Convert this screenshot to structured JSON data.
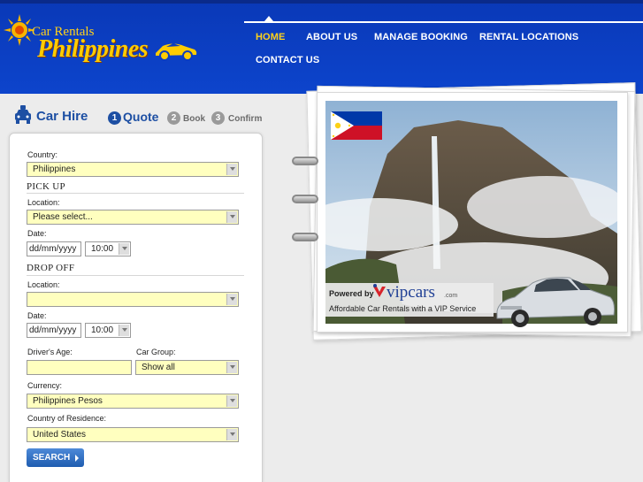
{
  "logo": {
    "top_text": "Car Rentals",
    "main_text": "Philippines",
    "colors": {
      "sun": "#f7b500",
      "text": "#ffcc00",
      "car": "#ffcc00"
    }
  },
  "nav": {
    "items": [
      {
        "label": "HOME",
        "active": true
      },
      {
        "label": "ABOUT US",
        "active": false
      },
      {
        "label": "MANAGE BOOKING",
        "active": false
      },
      {
        "label": "RENTAL LOCATIONS",
        "active": false
      },
      {
        "label": "CONTACT US",
        "active": false
      }
    ],
    "colors": {
      "background": "#0b3cc0",
      "active": "#ffd21a",
      "inactive": "#ffffff"
    }
  },
  "hire": {
    "title": "Car Hire",
    "steps": [
      {
        "number": "1",
        "label": "Quote",
        "current": true
      },
      {
        "number": "2",
        "label": "Book",
        "current": false
      },
      {
        "number": "3",
        "label": "Confirm",
        "current": false
      }
    ]
  },
  "form": {
    "country": {
      "label": "Country:",
      "value": "Philippines"
    },
    "pickup": {
      "heading": "PICK UP",
      "location_label": "Location:",
      "location_value": "Please select...",
      "date_label": "Date:",
      "date_value": "dd/mm/yyyy",
      "time_value": "10:00"
    },
    "dropoff": {
      "heading": "DROP OFF",
      "location_label": "Location:",
      "location_value": "",
      "date_label": "Date:",
      "date_value": "dd/mm/yyyy",
      "time_value": "10:00"
    },
    "age": {
      "label": "Driver's Age:",
      "value": ""
    },
    "car_group": {
      "label": "Car Group:",
      "value": "Show all"
    },
    "currency": {
      "label": "Currency:",
      "value": "Philippines Pesos"
    },
    "residence": {
      "label": "Country of Residence:",
      "value": "United States"
    },
    "search_label": "SEARCH",
    "colors": {
      "field_bg": "#ffffbf",
      "button": "#2f6fc4"
    }
  },
  "promo": {
    "powered_by": "Powered by",
    "brand": "vipcars",
    "brand_suffix": ".com",
    "tagline": "Affordable Car Rentals with a VIP Service",
    "icons": [
      "philippines-flag-icon",
      "waterfall-photo",
      "silver-sedan-car"
    ]
  }
}
